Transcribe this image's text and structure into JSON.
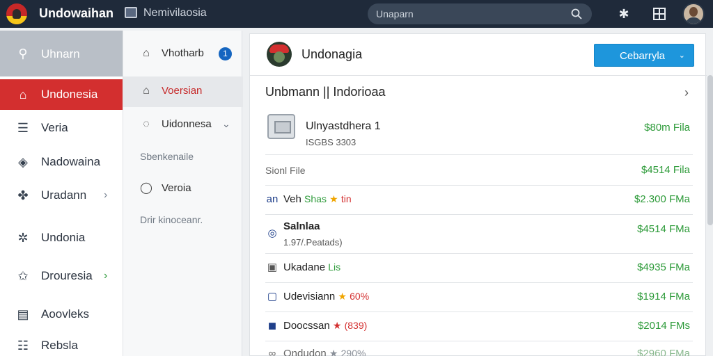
{
  "topbar": {
    "app_title": "Undowaihan",
    "doc_title": "Nemivilaosia",
    "search_placeholder": "Unaparn",
    "icons": [
      "search-icon",
      "puzzle-icon",
      "grid-icon"
    ]
  },
  "sidebar": {
    "items": [
      {
        "label": "Uhnarn",
        "icon": "search-icon",
        "glyph": "🔍"
      },
      {
        "label": "Undonesia",
        "icon": "home-icon",
        "glyph": "⌂"
      },
      {
        "label": "Veria",
        "icon": "list-icon",
        "glyph": "☰"
      },
      {
        "label": "Nadowaina",
        "icon": "shield-icon",
        "glyph": "◈"
      },
      {
        "label": "Uradann",
        "icon": "bird-icon",
        "glyph": "✤",
        "chevron": "›"
      },
      {
        "label": "Undonia",
        "icon": "gear-icon",
        "glyph": "✲"
      },
      {
        "label": "Drouresia",
        "icon": "star-icon",
        "glyph": "✩",
        "chevron": "›"
      },
      {
        "label": "Aoovleks",
        "icon": "building-icon",
        "glyph": "▤"
      },
      {
        "label": "Rebsla",
        "icon": "layers-icon",
        "glyph": "☷"
      }
    ]
  },
  "subnav": {
    "items": [
      {
        "label": "Vhotharb",
        "icon": "home-outline-icon",
        "glyph": "⌂",
        "badge": "1"
      },
      {
        "label": "Voersian",
        "icon": "home-outline-icon",
        "glyph": "⌂"
      },
      {
        "label": "Uidonnesa",
        "icon": "chat-icon",
        "glyph": "◌",
        "chevron": "⌄"
      },
      {
        "label": "Veroia",
        "icon": "shield-outline-icon",
        "glyph": "◯"
      }
    ],
    "sections": [
      "Sbenkenaile",
      "Drir kinoceanr."
    ]
  },
  "main": {
    "title": "Undonagia",
    "primary_button": "Cebarryla",
    "breadcrumb": "Unbmann || Indorioaa",
    "rows": [
      {
        "name": "Ulnyastdhera 1",
        "sub": "ISGBS 3303",
        "price": "$80m Fila"
      },
      {
        "name": "Sionl File",
        "price": "$4514 Fila"
      },
      {
        "name": "Veh",
        "prefix": "an",
        "tag": "Shas",
        "tag2": "tin",
        "price": "$2.300 FMa"
      },
      {
        "name": "Salnlaa",
        "sub": "1.97/.Peatads)",
        "price": "$4514 FMa"
      },
      {
        "name": "Ukadane",
        "tag": "Lis",
        "price": "$4935 FMa"
      },
      {
        "name": "Udevisiann",
        "tag": "60%",
        "price": "$1914 FMa"
      },
      {
        "name": "Doocssan",
        "tag": "(839)",
        "price": "$2014 FMs"
      },
      {
        "name": "Ondudon",
        "tag": "290%",
        "price": "$2960 FMa"
      }
    ]
  },
  "colors": {
    "topbar": "#1f2a3a",
    "accent_red": "#d32f2f",
    "accent_blue": "#1e96dc",
    "price_green": "#2e9b3a"
  }
}
